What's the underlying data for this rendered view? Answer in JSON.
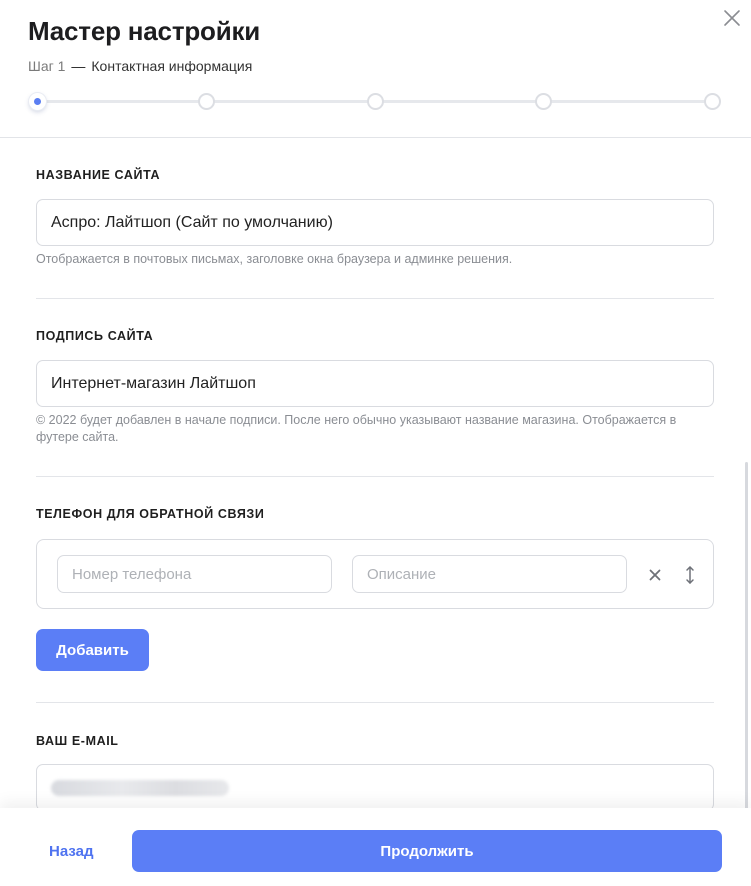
{
  "header": {
    "title": "Мастер настройки",
    "step_label": "Шаг 1",
    "step_dash": "—",
    "step_name": "Контактная информация"
  },
  "progress": {
    "total_steps": 5,
    "current_step": 1,
    "accent_color": "#5b7ef2"
  },
  "icons": {
    "close": "close-icon",
    "remove": "close-icon",
    "reorder": "drag-vertical-icon"
  },
  "fields": {
    "site_name": {
      "label": "Название сайта",
      "value": "Аспро: Лайтшоп (Сайт по умолчанию)",
      "hint": "Отображается в почтовых письмах, заголовке окна браузера и админке решения."
    },
    "site_signature": {
      "label": "Подпись сайта",
      "value": "Интернет-магазин Лайтшоп",
      "hint": "© 2022 будет добавлен в начале подписи. После него обычно указывают название магазина. Отображается в футере сайта."
    },
    "phone": {
      "label": "Телефон для обратной связи",
      "number_placeholder": "Номер телефона",
      "description_placeholder": "Описание",
      "add_label": "Добавить"
    },
    "email": {
      "label": "Ваш e-mail"
    }
  },
  "footer": {
    "back_label": "Назад",
    "next_label": "Продолжить"
  },
  "colors": {
    "primary": "#5b7ef6",
    "text": "#222222",
    "hint": "#8a8d93",
    "border": "#d9dbe0"
  }
}
